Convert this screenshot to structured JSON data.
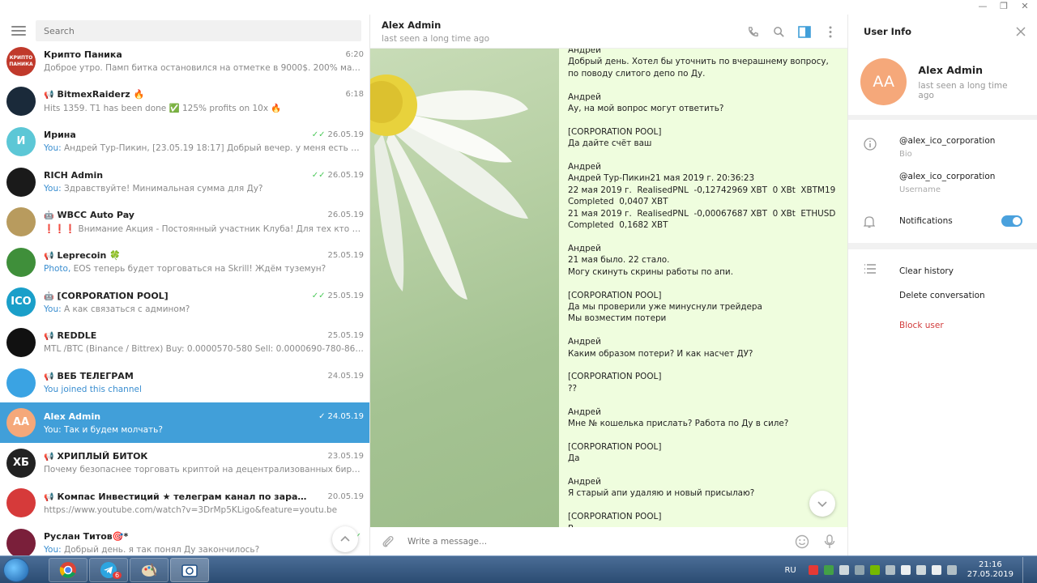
{
  "window": {
    "controls": [
      "—",
      "❐",
      "✕"
    ]
  },
  "sidebar": {
    "search_placeholder": "Search",
    "chats": [
      {
        "name": "Крипто Паника",
        "time": "6:20",
        "ticks": "",
        "you": "",
        "preview": "Доброе утро. Памп битка остановился на отметке в 9000$. 200% маржу проб...",
        "avatar_text": "КРИПТО ПАНИКА",
        "avatar_color": "#c0392b",
        "icon": ""
      },
      {
        "name": "BitmexRaiderz 🔥",
        "time": "6:18",
        "ticks": "",
        "you": "",
        "preview": "Hits 1359. T1 has been done ✅ 125% profits on 10x 🔥",
        "avatar_text": "",
        "avatar_color": "#1a2a3a",
        "icon": "📢"
      },
      {
        "name": "Ирина",
        "time": "26.05.19",
        "ticks": "✓✓",
        "you": "You:",
        "preview": "Андрей Тур-Пикин, [23.05.19 18:17] Добрый вечер. у меня есть вопросы п...",
        "avatar_text": "И",
        "avatar_color": "#5cc7d6",
        "icon": ""
      },
      {
        "name": "RICH Admin",
        "time": "26.05.19",
        "ticks": "✓✓",
        "you": "You:",
        "preview": "Здравствуйте! Минимальная сумма для Ду?",
        "avatar_text": "",
        "avatar_color": "#1a1a1a",
        "icon": ""
      },
      {
        "name": "WBCC Auto Pay",
        "time": "26.05.19",
        "ticks": "",
        "you": "",
        "preview": "❗❗❗ Внимание Акция - Постоянный участник Клуба!   Для тех кто хочет ...",
        "avatar_text": "",
        "avatar_color": "#b89b5e",
        "icon": "🤖"
      },
      {
        "name": "Leprecoin 🍀",
        "time": "25.05.19",
        "ticks": "",
        "you": "Photo,",
        "preview": "EOS теперь будет торговаться на Skrill! Ждём туземун?",
        "avatar_text": "",
        "avatar_color": "#3f8f3a",
        "icon": "📢"
      },
      {
        "name": "[CORPORATION POOL]",
        "time": "25.05.19",
        "ticks": "✓✓",
        "you": "You:",
        "preview": "А как связаться с админом?",
        "avatar_text": "ICO",
        "avatar_color": "#1a9fc9",
        "icon": "🤖"
      },
      {
        "name": "REDDLE",
        "time": "25.05.19",
        "ticks": "",
        "you": "",
        "preview": "MTL /BTC (Binance / Bittrex)  Buy: 0.0000570-580  Sell: 0.0000690-780-860-990+",
        "avatar_text": "",
        "avatar_color": "#111111",
        "icon": "📢"
      },
      {
        "name": "ВЕБ ТЕЛЕГРАМ",
        "time": "24.05.19",
        "ticks": "",
        "you": "You joined this channel",
        "preview": "",
        "avatar_text": "",
        "avatar_color": "#3aa3e3",
        "icon": "📢"
      },
      {
        "name": "Alex Admin",
        "time": "24.05.19",
        "ticks": "✓",
        "you": "You:",
        "preview": "Так и будем молчать?",
        "avatar_text": "AA",
        "avatar_color": "#f5a87a",
        "icon": ""
      },
      {
        "name": "ХРИПЛЫЙ БИТОК",
        "time": "23.05.19",
        "ticks": "",
        "you": "",
        "preview": "Почему безопаснее торговать криптой на децентрализованных биржах? ...",
        "avatar_text": "ХБ",
        "avatar_color": "#222222",
        "icon": "📢"
      },
      {
        "name": "Компас Инвестиций ★ телеграм канал по заработку",
        "time": "20.05.19",
        "ticks": "",
        "you": "",
        "preview": "https://www.youtube.com/watch?v=3DrMp5KLigo&feature=youtu.be",
        "avatar_text": "",
        "avatar_color": "#d63a3a",
        "icon": "📢"
      },
      {
        "name": "Руслан Титов🎯*",
        "time": "",
        "ticks": "✓✓",
        "you": "You:",
        "preview": "Добрый день. я так понял Ду закончилось?",
        "avatar_text": "",
        "avatar_color": "#7a1f3a",
        "icon": ""
      }
    ]
  },
  "conversation": {
    "title": "Alex Admin",
    "status": "last seen a long time ago",
    "messages": "Андрей\nДобрый день. Хотел бы уточнить по вчерашнему вопросу, по поводу слитого депо по Ду.\n\nАндрей\nАу, на мой вопрос могут ответить?\n\n[CORPORATION POOL]\nДа дайте счёт ваш\n\nАндрей\nАндрей Тур-Пикин21 мая 2019 г. 20:36:23\n22 мая 2019 г.  RealisedPNL  -0,12742969 XBT  0 XBt  XBTM19\nCompleted  0,0407 XBT\n21 мая 2019 г.  RealisedPNL  -0,00067687 XBT  0 XBt  ETHUSD\nCompleted  0,1682 XBT\n\nАндрей\n21 мая было. 22 стало.\nМогу скинуть скрины работы по апи.\n\n[CORPORATION POOL]\nДа мы проверили уже минуснули трейдера\nМы возместим потери\n\nАндрей\nКаким образом потери? И как насчет ДУ?\n\n[CORPORATION POOL]\n??\n\nАндрей\nМне № кошелька прислать? Работа по Ду в силе?\n\n[CORPORATION POOL]\nДа\n\nАндрей\nЯ старый апи удаляю и новый присылаю?\n\n[CORPORATION POOL]\nВ",
    "compose_placeholder": "Write a message..."
  },
  "user_info": {
    "title": "User Info",
    "name": "Alex Admin",
    "status": "last seen a long time ago",
    "avatar_text": "AA",
    "bio": "@alex_ico_corporation",
    "bio_label": "Bio",
    "username": "@alex_ico_corporation",
    "username_label": "Username",
    "notifications_label": "Notifications",
    "notifications_on": true,
    "clear_history": "Clear history",
    "delete_conversation": "Delete conversation",
    "block_user": "Block user"
  },
  "taskbar": {
    "lang": "RU",
    "time": "21:16",
    "date": "27.05.2019",
    "telegram_badge": "6"
  },
  "colors": {
    "accent": "#419fd9",
    "bubble": "#effdde",
    "danger": "#d23d3d"
  }
}
